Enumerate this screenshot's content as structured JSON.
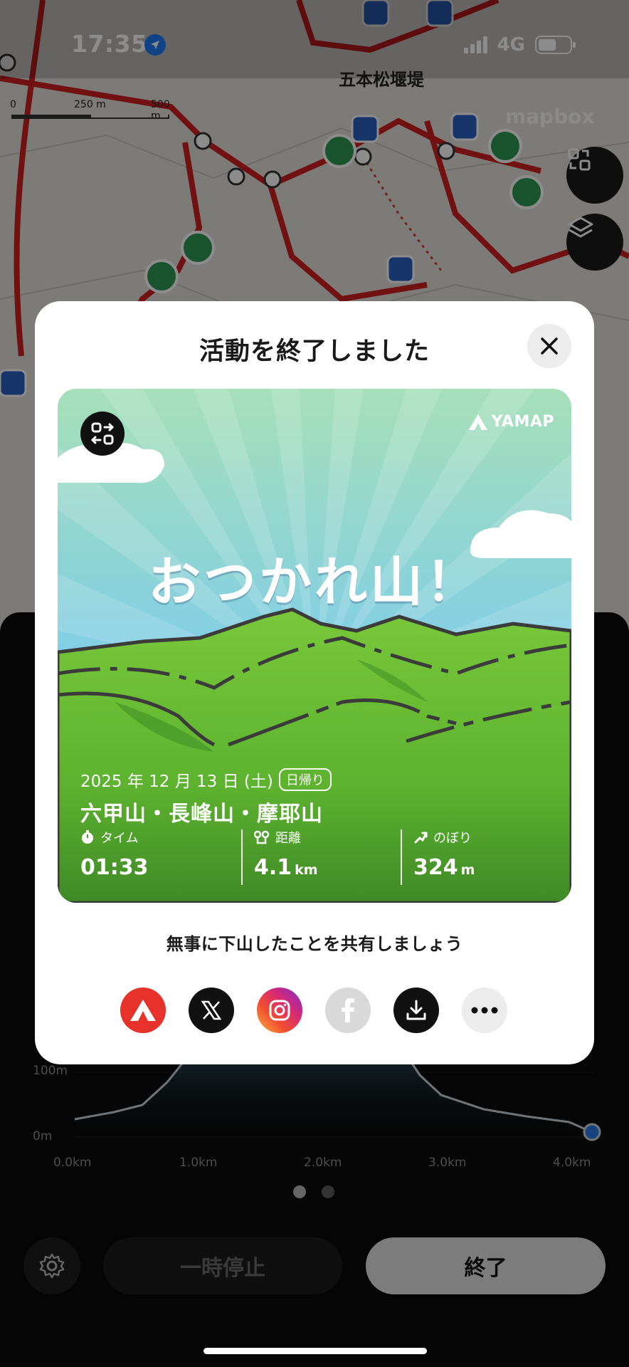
{
  "status_bar": {
    "time": "17:35",
    "network": "4G"
  },
  "map": {
    "scale_labels": [
      "0",
      "250 m",
      "500 m"
    ],
    "place_label": "五本松堰堤",
    "attribution": "mapbox"
  },
  "tracking": {
    "elevation_y_labels": [
      "100m",
      "0m"
    ],
    "distance_x_labels": [
      "0.0km",
      "1.0km",
      "2.0km",
      "3.0km",
      "4.0km"
    ],
    "pause_label": "一時停止",
    "finish_label": "終了"
  },
  "modal": {
    "title": "活動を終了しました",
    "card": {
      "brand": "YAMAP",
      "headline": "おつかれ山！",
      "date": "2025 年 12 月 13 日 (土)",
      "trip_type": "日帰り",
      "place": "六甲山・長峰山・摩耶山",
      "stats": [
        {
          "label": "タイム",
          "value": "01:33",
          "unit": ""
        },
        {
          "label": "距離",
          "value": "4.1",
          "unit": "km"
        },
        {
          "label": "のぼり",
          "value": "324",
          "unit": "m"
        }
      ]
    },
    "share_prompt": "無事に下山したことを共有しましょう",
    "share_targets": [
      "yamap-icon",
      "x-icon",
      "instagram-icon",
      "facebook-icon",
      "download-icon",
      "more-icon"
    ]
  },
  "colors": {
    "accent_red": "#e6322a",
    "card_green": "#5fb52e",
    "sky_blue": "#7cc9e6",
    "instagram": "#d62976"
  }
}
